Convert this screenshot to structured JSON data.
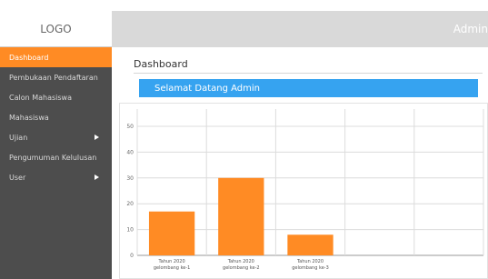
{
  "brand": {
    "logo_text": "LOGO"
  },
  "topbar": {
    "user_label": "Admin"
  },
  "sidebar": {
    "items": [
      {
        "label": "Dashboard",
        "active": true,
        "has_submenu": false
      },
      {
        "label": "Pembukaan Pendaftaran",
        "active": false,
        "has_submenu": false
      },
      {
        "label": "Calon Mahasiswa",
        "active": false,
        "has_submenu": false
      },
      {
        "label": "Mahasiswa",
        "active": false,
        "has_submenu": false
      },
      {
        "label": "Ujian",
        "active": false,
        "has_submenu": true
      },
      {
        "label": "Pengumuman Kelulusan",
        "active": false,
        "has_submenu": false
      },
      {
        "label": "User",
        "active": false,
        "has_submenu": true
      }
    ]
  },
  "main": {
    "page_title": "Dashboard",
    "welcome_text": "Selamat Datang Admin"
  },
  "colors": {
    "accent": "#ff8b24",
    "welcome_bar": "#36a3f0",
    "sidebar_bg": "#4d4d4d",
    "topbar_bg": "#d9d9d9"
  },
  "chart_data": {
    "type": "bar",
    "categories": [
      [
        "Tahun 2020",
        "gelombang ke-1"
      ],
      [
        "Tahun 2020",
        "gelombang ke-2"
      ],
      [
        "Tahun 2020",
        "gelombang ke-3"
      ],
      [
        "",
        ""
      ],
      [
        "",
        ""
      ]
    ],
    "values": [
      17,
      30,
      8,
      null,
      null
    ],
    "ylim": [
      0,
      50
    ],
    "yticks": [
      0,
      10,
      20,
      30,
      40,
      50
    ],
    "grid": true,
    "bar_color": "#ff8b24",
    "title": "",
    "xlabel": "",
    "ylabel": ""
  }
}
